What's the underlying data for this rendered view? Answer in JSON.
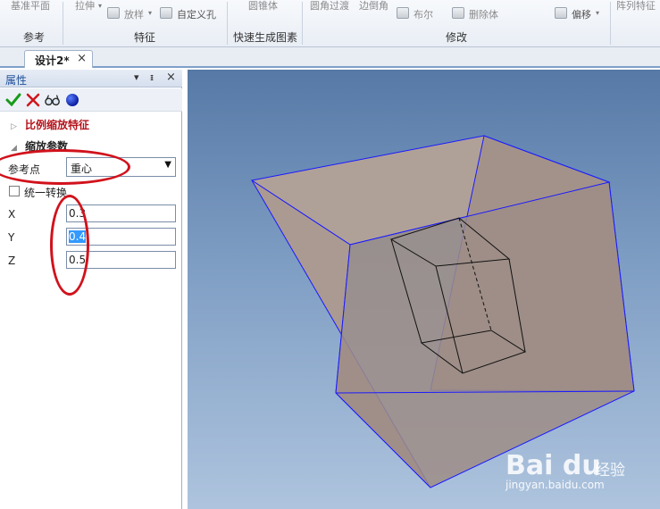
{
  "ribbon": {
    "groups": {
      "reference": {
        "label": "参考",
        "items": [
          "基准平面"
        ]
      },
      "feature": {
        "label": "特征",
        "items": [
          "拉伸",
          "放样",
          "自定义孔"
        ]
      },
      "quick": {
        "label": "快速生成图素",
        "items": [
          "圆锥体"
        ]
      },
      "modify": {
        "label": "修改",
        "items": [
          "圆角过渡",
          "边倒角",
          "布尔",
          "删除体",
          "偏移"
        ]
      },
      "pattern": {
        "items": [
          "阵列特征"
        ]
      }
    }
  },
  "tabs": {
    "document": "设计2*",
    "close": "×"
  },
  "panel": {
    "title": "属性",
    "pin": "ᵻ",
    "close": "×",
    "section_scale_feature": "比例缩放特征",
    "section_scale_params": "缩放参数",
    "ref_point": {
      "label": "参考点",
      "value": "重心"
    },
    "unify": {
      "label": "统一转换"
    },
    "x": {
      "label": "X",
      "value": "0.3"
    },
    "y": {
      "label": "Y",
      "value": "0.4"
    },
    "z": {
      "label": "Z",
      "value": "0.5"
    }
  },
  "toolbar_icons": [
    "check-icon",
    "cross-icon",
    "glasses-icon",
    "blue-dot-icon"
  ],
  "colors": {
    "accent": "#1f4f9a",
    "annotation": "#d1121c",
    "feature_heading": "#b4121a",
    "shape_fill": "#a89890",
    "shape_edge": "#1a1aff"
  },
  "watermark": {
    "logo": "Bai du",
    "brand": "经验",
    "url": "jingyan.baidu.com"
  }
}
